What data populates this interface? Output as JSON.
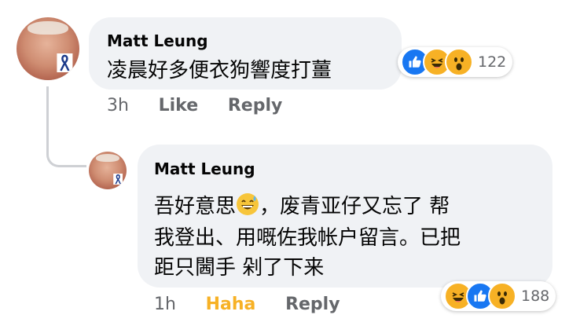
{
  "comment": {
    "author": "Matt Leung",
    "text": "凌晨好多便衣狗響度打薑",
    "time": "3h",
    "like_label": "Like",
    "reply_label": "Reply",
    "reactions": [
      "like-icon",
      "haha-icon",
      "wow-icon"
    ],
    "reaction_count": "122"
  },
  "reply": {
    "author": "Matt Leung",
    "line1_a": "吾好意思",
    "line1_b": "，废青亚仔又忘了 帮",
    "line2": "我登出、用嘅佐我帐户留言。已把",
    "line3": "距只閪手 剁了下来",
    "time": "1h",
    "reaction_label": "Haha",
    "reply_label": "Reply",
    "reactions": [
      "haha-icon",
      "like-icon",
      "wow-icon"
    ],
    "reaction_count": "188"
  },
  "colors": {
    "bubble": "#f0f2f5",
    "meta": "#65676b",
    "like": "#1877f2",
    "haha": "#f7b125"
  }
}
